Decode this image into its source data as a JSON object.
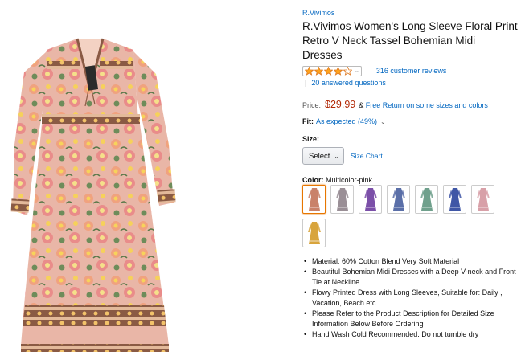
{
  "product": {
    "brand": "R.Vivimos",
    "title": "R.Vivimos Women's Long Sleeve Floral Print Retro V Neck Tassel Bohemian Midi Dresses",
    "rating": 4,
    "reviews": "316 customer reviews",
    "answered": "20 answered questions",
    "price_label": "Price:",
    "price": "$29.99",
    "return_prefix": "&",
    "return_link": "Free Return on some sizes and colors",
    "fit_label": "Fit:",
    "fit_value": "As expected (49%)",
    "size_label": "Size:",
    "size_select": "Select",
    "size_chart": "Size Chart",
    "color_label": "Color:",
    "color_value": "Multicolor-pink"
  },
  "swatches": [
    {
      "name": "Multicolor-pink",
      "color": "#c9826a",
      "selected": true
    },
    {
      "name": "Gray",
      "color": "#9a8f96",
      "selected": false
    },
    {
      "name": "Purple",
      "color": "#7b4fa8",
      "selected": false
    },
    {
      "name": "Blue",
      "color": "#5a6fa8",
      "selected": false
    },
    {
      "name": "Green",
      "color": "#6fa08c",
      "selected": false
    },
    {
      "name": "Navy",
      "color": "#3f56a6",
      "selected": false
    },
    {
      "name": "Pink",
      "color": "#d8a0a8",
      "selected": false
    },
    {
      "name": "Yellow",
      "color": "#d8a43c",
      "selected": false
    }
  ],
  "bullets": [
    "Material: 60% Cotton Blend Very Soft Material",
    "Beautiful Bohemian Midi Dresses with a Deep V-neck and Front Tie at Neckline",
    "Flowy Printed Dress with Long Sleeves, Suitable for: Daily , Vacation, Beach etc.",
    "Please Refer to the Product Description for Detailed Size Information Below Before Ordering",
    "Hand Wash Cold Recommended. Do not tumble dry"
  ],
  "colors": {
    "link": "#0066c0",
    "price": "#b12704",
    "star": "#ffa41c",
    "dress_base": "#e7b3a6",
    "dress_band": "#8a5a44"
  }
}
